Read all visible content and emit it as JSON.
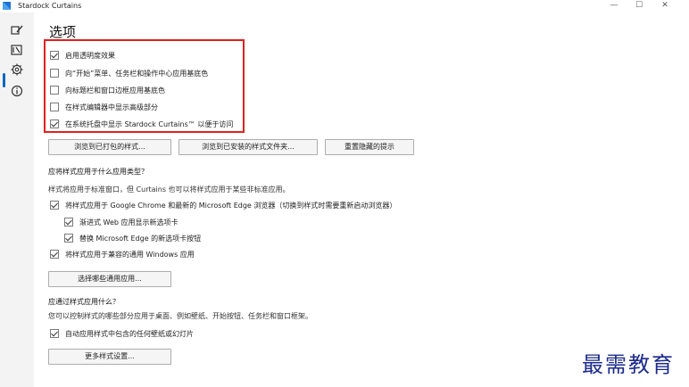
{
  "window": {
    "title": "Stardock Curtains",
    "controls": {
      "minimize": "—",
      "maximize": "☐",
      "close": "✕"
    }
  },
  "sidebar": {
    "items": [
      {
        "name": "brush-icon",
        "selected": false
      },
      {
        "name": "image-icon",
        "selected": false
      },
      {
        "name": "gear-icon",
        "selected": true
      },
      {
        "name": "info-icon",
        "selected": false
      }
    ],
    "accent": "#0067c0"
  },
  "page": {
    "title": "选项",
    "options": [
      {
        "label": "启用透明度效果",
        "checked": true
      },
      {
        "label": "向“开始”菜单、任务栏和操作中心应用基底色",
        "checked": false
      },
      {
        "label": "向标题栏和窗口边框应用基底色",
        "checked": false
      },
      {
        "label": "在样式编辑器中显示高级部分",
        "checked": false
      },
      {
        "label": "在系统托盘中显示 Stardock Curtains™ 以便于访问",
        "checked": true
      }
    ],
    "buttons": {
      "browse_packaged": "浏览到已打包的样式...",
      "browse_installed": "浏览到已安装的样式文件夹...",
      "reset_hidden": "重置隐藏的提示"
    },
    "apps_section": {
      "heading": "应将样式应用于什么应用类型？",
      "description": "样式将应用于标准窗口，但 Curtains 也可以将样式应用于某些非标准应用。",
      "apply_browsers": {
        "label": "将样式应用于 Google Chrome 和最新的 Microsoft Edge 浏览器（切换到样式时需要重新启动浏览器）",
        "checked": true
      },
      "show_tabs_button": {
        "label": "渐进式 Web 应用显示新选项卡",
        "checked": true
      },
      "replace_edge_tab_button": {
        "label": "替换 Microsoft Edge 的新选项卡按钮",
        "checked": true
      },
      "apply_uwp": {
        "label": "将样式应用于兼容的通用 Windows 应用",
        "checked": true
      },
      "select_apps_button": "选择哪些通用应用..."
    },
    "parts_section": {
      "heading": "应通过样式应用什么？",
      "description": "您可以控制样式的哪些部分应用于桌面、例如壁纸、开始按钮、任务栏和窗口框架。",
      "auto_apply": {
        "label": "自动应用样式中包含的任何壁纸或幻灯片",
        "checked": true
      },
      "more_settings_button": "更多样式设置..."
    }
  },
  "watermark": {
    "text": "最需教育"
  }
}
